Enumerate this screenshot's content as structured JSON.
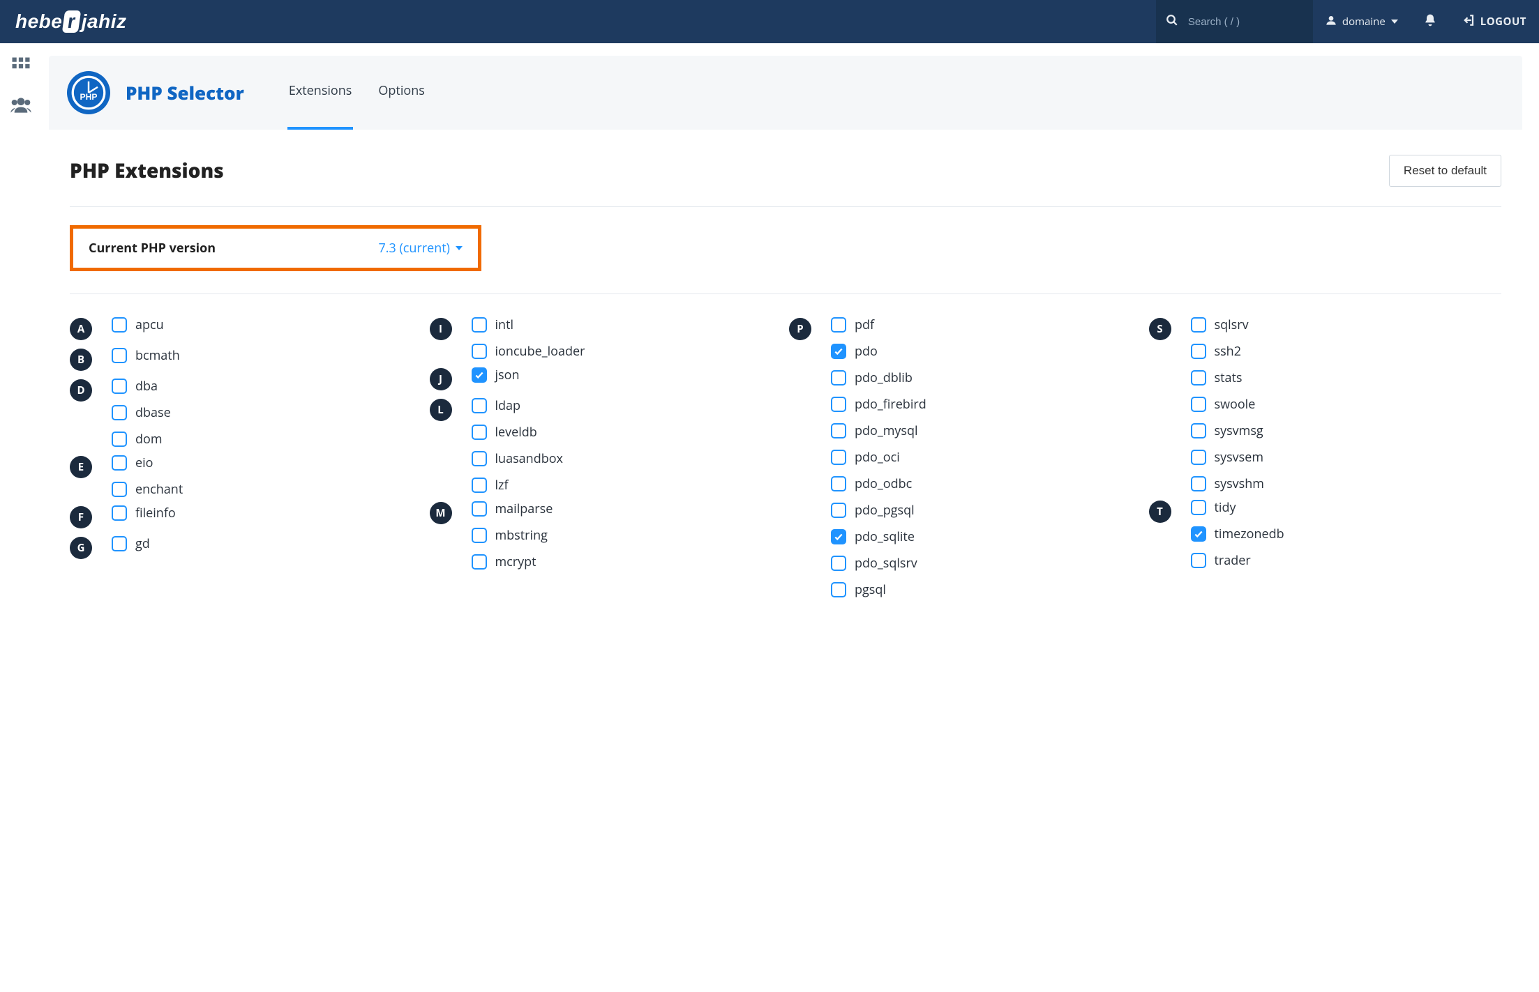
{
  "navbar": {
    "brand": "heberjahiz",
    "search_placeholder": "Search ( / )",
    "user_label": "domaine",
    "logout_label": "LOGOUT"
  },
  "page": {
    "title": "PHP Selector",
    "tabs": [
      {
        "id": "extensions",
        "label": "Extensions",
        "active": true
      },
      {
        "id": "options",
        "label": "Options",
        "active": false
      }
    ]
  },
  "section": {
    "heading": "PHP Extensions",
    "reset_label": "Reset to default",
    "version_label": "Current PHP version",
    "version_value": "7.3 (current)"
  },
  "columns": [
    [
      {
        "letter": "A",
        "items": [
          {
            "name": "apcu",
            "checked": false
          }
        ]
      },
      {
        "letter": "B",
        "items": [
          {
            "name": "bcmath",
            "checked": false
          }
        ]
      },
      {
        "letter": "D",
        "items": [
          {
            "name": "dba",
            "checked": false
          },
          {
            "name": "dbase",
            "checked": false
          },
          {
            "name": "dom",
            "checked": false
          }
        ]
      },
      {
        "letter": "E",
        "items": [
          {
            "name": "eio",
            "checked": false
          },
          {
            "name": "enchant",
            "checked": false
          }
        ]
      },
      {
        "letter": "F",
        "items": [
          {
            "name": "fileinfo",
            "checked": false
          }
        ]
      },
      {
        "letter": "G",
        "items": [
          {
            "name": "gd",
            "checked": false
          }
        ]
      }
    ],
    [
      {
        "letter": "I",
        "items": [
          {
            "name": "intl",
            "checked": false
          },
          {
            "name": "ioncube_loader",
            "checked": false
          }
        ]
      },
      {
        "letter": "J",
        "items": [
          {
            "name": "json",
            "checked": true
          }
        ]
      },
      {
        "letter": "L",
        "items": [
          {
            "name": "ldap",
            "checked": false
          },
          {
            "name": "leveldb",
            "checked": false
          },
          {
            "name": "luasandbox",
            "checked": false
          },
          {
            "name": "lzf",
            "checked": false
          }
        ]
      },
      {
        "letter": "M",
        "items": [
          {
            "name": "mailparse",
            "checked": false
          },
          {
            "name": "mbstring",
            "checked": false
          },
          {
            "name": "mcrypt",
            "checked": false
          }
        ]
      }
    ],
    [
      {
        "letter": "P",
        "items": [
          {
            "name": "pdf",
            "checked": false
          },
          {
            "name": "pdo",
            "checked": true
          },
          {
            "name": "pdo_dblib",
            "checked": false
          },
          {
            "name": "pdo_firebird",
            "checked": false
          },
          {
            "name": "pdo_mysql",
            "checked": false
          },
          {
            "name": "pdo_oci",
            "checked": false
          },
          {
            "name": "pdo_odbc",
            "checked": false
          },
          {
            "name": "pdo_pgsql",
            "checked": false
          },
          {
            "name": "pdo_sqlite",
            "checked": true
          },
          {
            "name": "pdo_sqlsrv",
            "checked": false
          },
          {
            "name": "pgsql",
            "checked": false
          }
        ]
      }
    ],
    [
      {
        "letter": "S",
        "items": [
          {
            "name": "sqlsrv",
            "checked": false
          },
          {
            "name": "ssh2",
            "checked": false
          },
          {
            "name": "stats",
            "checked": false
          },
          {
            "name": "swoole",
            "checked": false
          },
          {
            "name": "sysvmsg",
            "checked": false
          },
          {
            "name": "sysvsem",
            "checked": false
          },
          {
            "name": "sysvshm",
            "checked": false
          }
        ]
      },
      {
        "letter": "T",
        "items": [
          {
            "name": "tidy",
            "checked": false
          },
          {
            "name": "timezonedb",
            "checked": true
          },
          {
            "name": "trader",
            "checked": false
          }
        ]
      }
    ]
  ]
}
